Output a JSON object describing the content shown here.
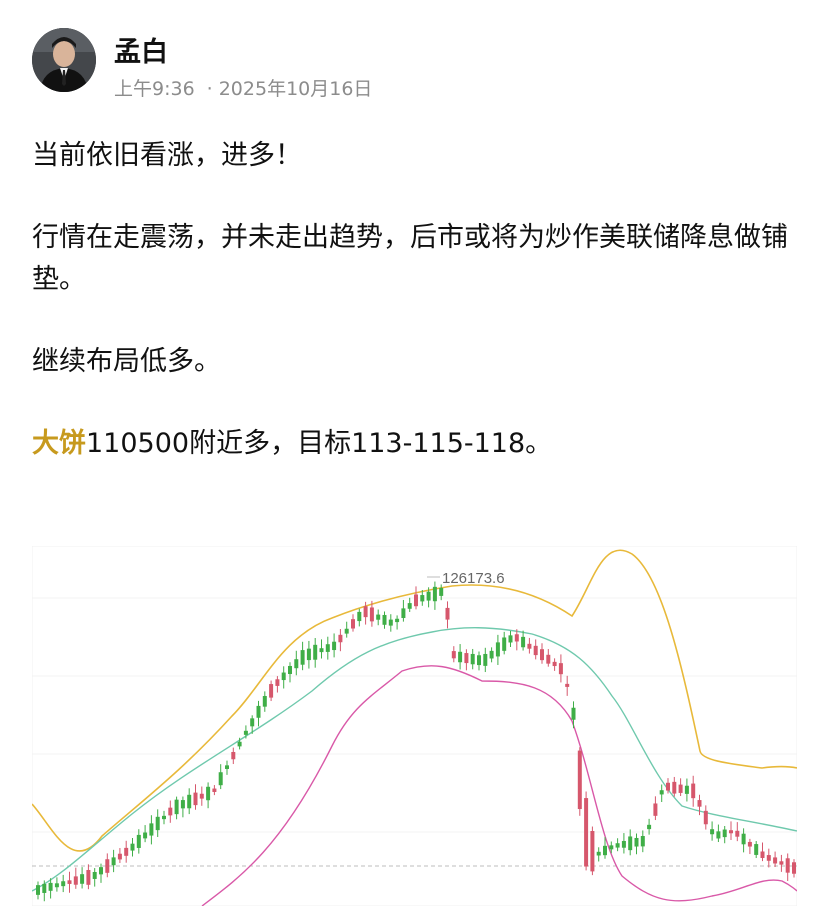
{
  "post": {
    "author": "孟白",
    "time": "上午9:36",
    "separator": "·",
    "date": "2025年10月16日",
    "p1": "当前依旧看涨，进多！",
    "p2": "行情在走震荡，并未走出趋势，后市或将为炒作美联储降息做铺垫。",
    "p3": "继续布局低多。",
    "p4_highlight": "大饼",
    "p4_rest": "110500附近多，目标113-115-118。"
  },
  "colors": {
    "highlight": "#c79a1e",
    "up_candle": "#3fae47",
    "down_candle": "#d6576c",
    "upper_band": "#e8b93a",
    "middle_band": "#6fc9ad",
    "lower_band": "#d959a8"
  },
  "chart_data": {
    "type": "candlestick",
    "annotation": "126173.6",
    "indicator": "bollinger bands",
    "grid": true
  }
}
